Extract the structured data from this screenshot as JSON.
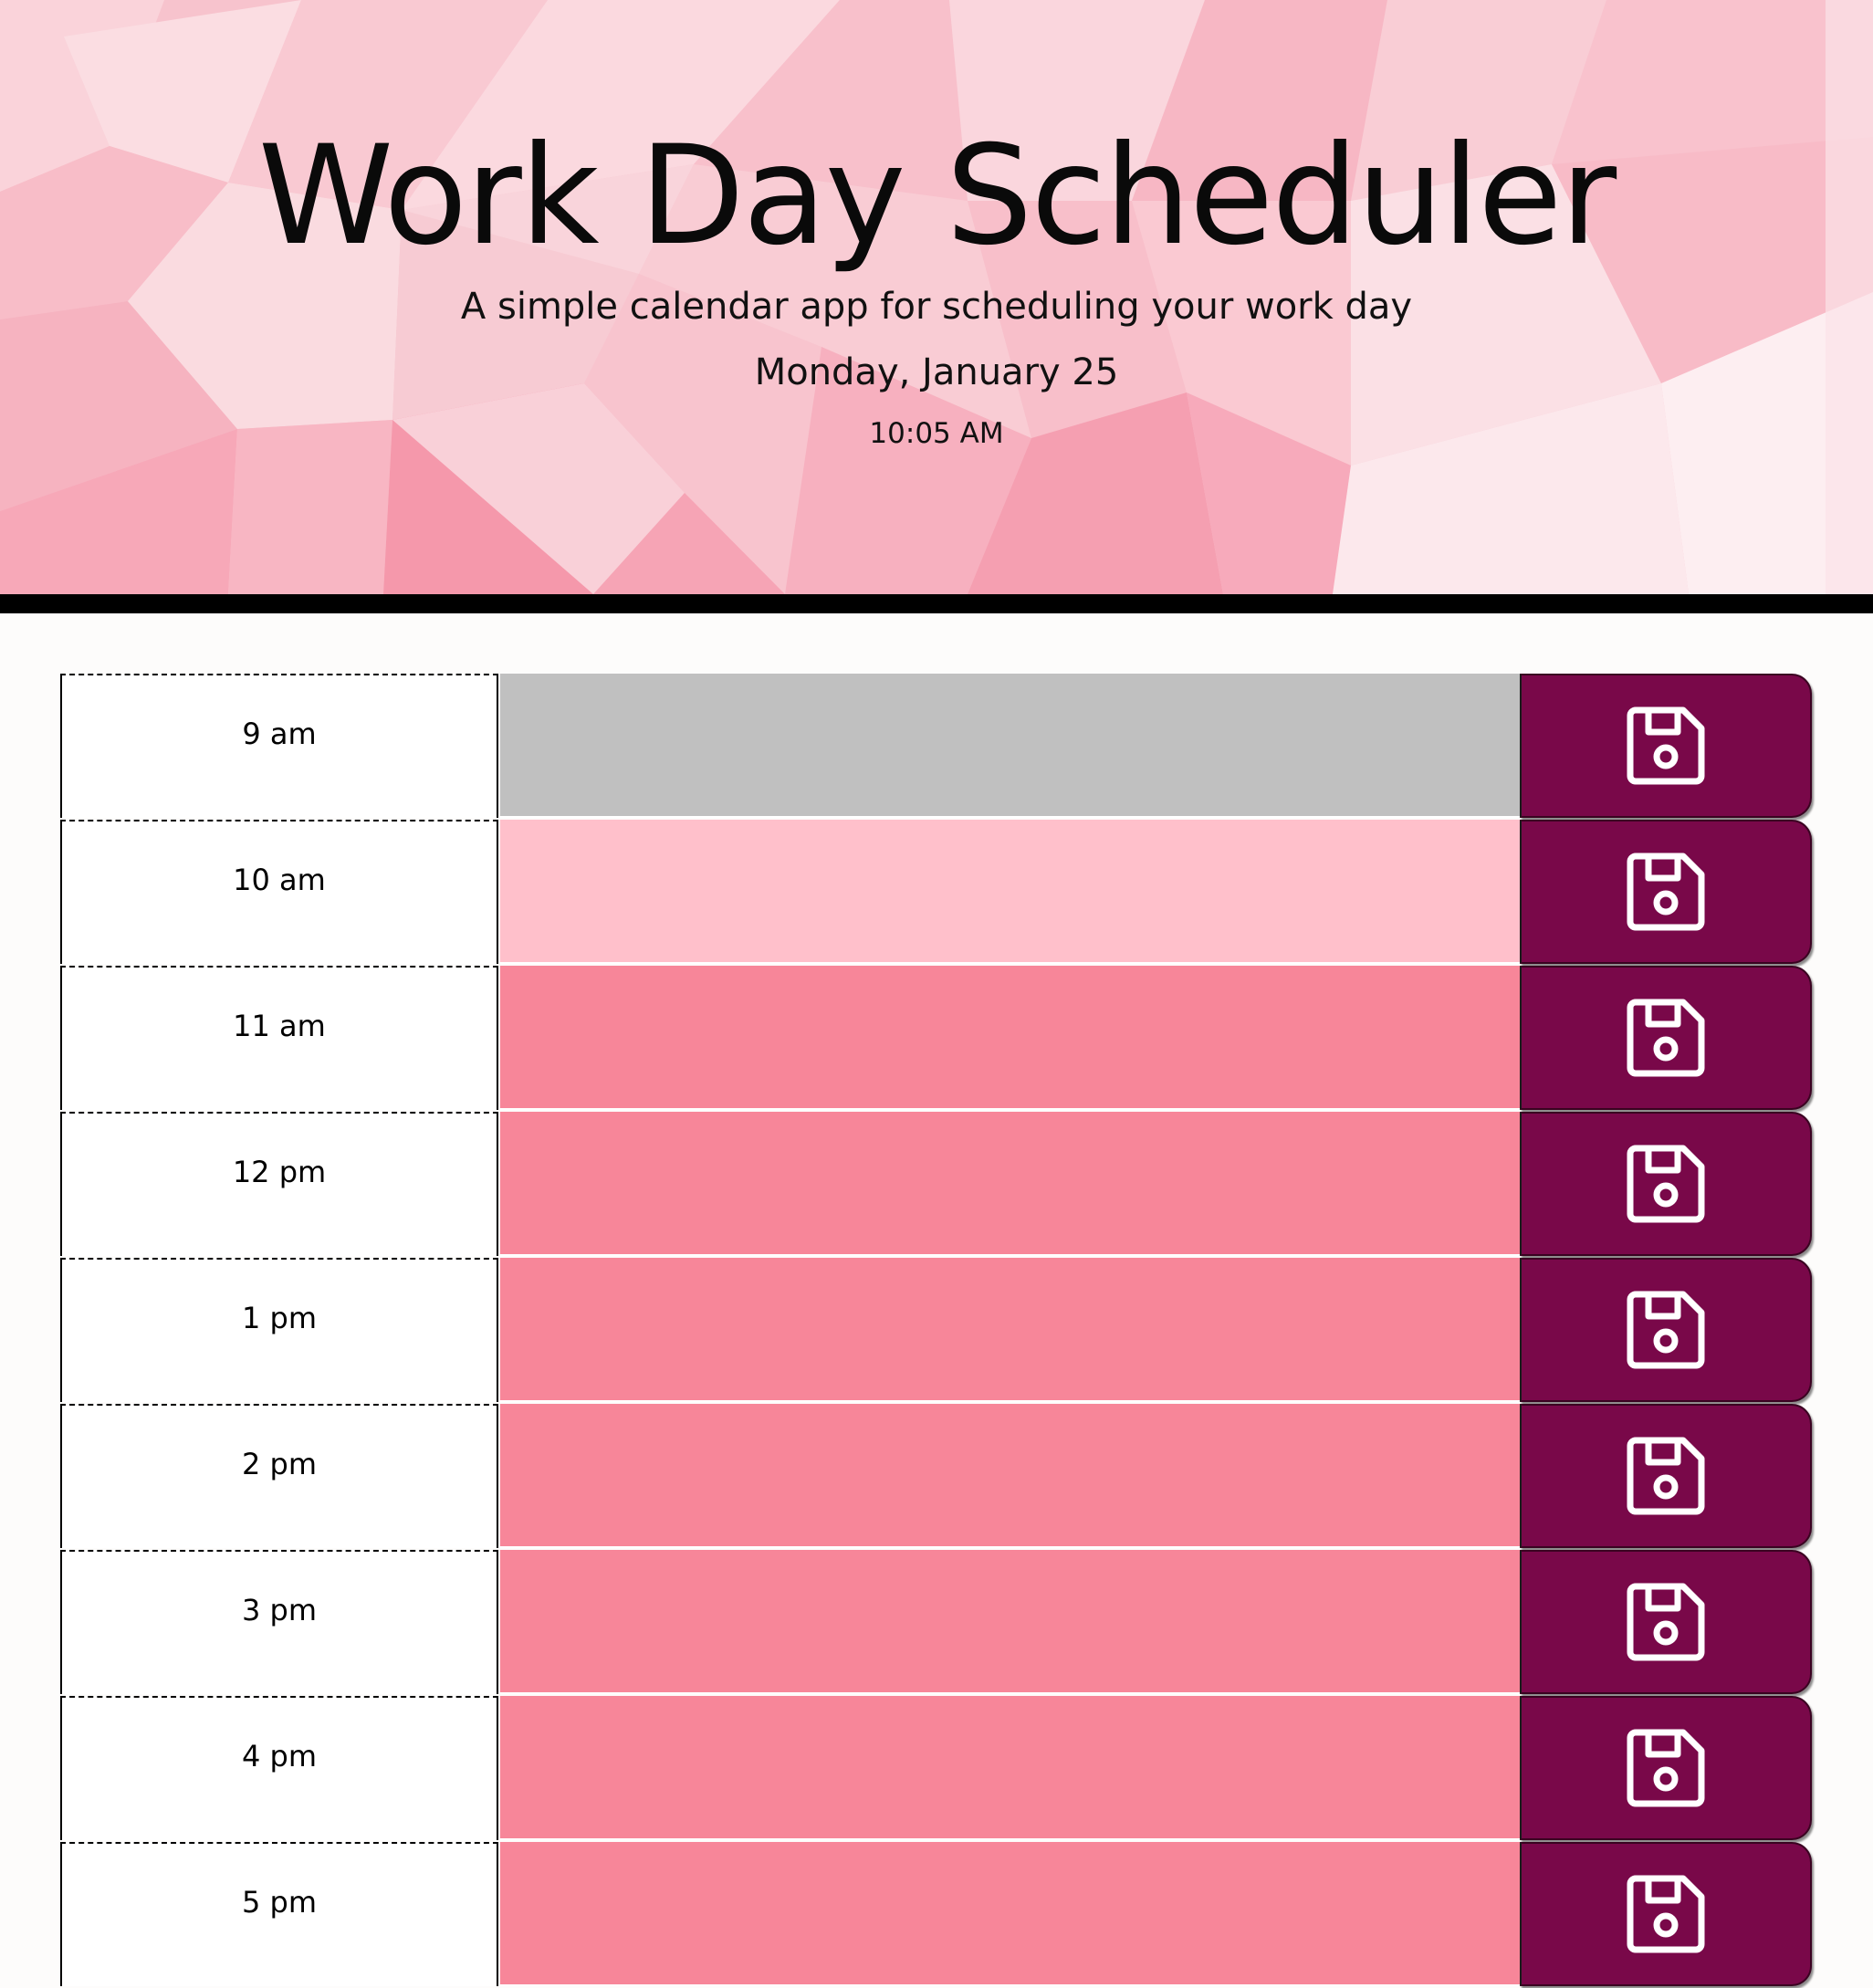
{
  "header": {
    "title": "Work Day Scheduler",
    "subtitle": "A simple calendar app for scheduling your work day",
    "date": "Monday, January 25",
    "time": "10:05 AM"
  },
  "colors": {
    "past": "#c0c0c0",
    "present": "#ffc0cb",
    "future": "#f78699",
    "save_button": "#790849",
    "divider": "#000000"
  },
  "schedule": {
    "rows": [
      {
        "hour": "9 am",
        "status": "past",
        "text": ""
      },
      {
        "hour": "10 am",
        "status": "present",
        "text": ""
      },
      {
        "hour": "11 am",
        "status": "future",
        "text": ""
      },
      {
        "hour": "12 pm",
        "status": "future",
        "text": ""
      },
      {
        "hour": "1 pm",
        "status": "future",
        "text": ""
      },
      {
        "hour": "2 pm",
        "status": "future",
        "text": ""
      },
      {
        "hour": "3 pm",
        "status": "future",
        "text": ""
      },
      {
        "hour": "4 pm",
        "status": "future",
        "text": ""
      },
      {
        "hour": "5 pm",
        "status": "future",
        "text": ""
      }
    ],
    "save_icon": "floppy-disk-icon"
  }
}
